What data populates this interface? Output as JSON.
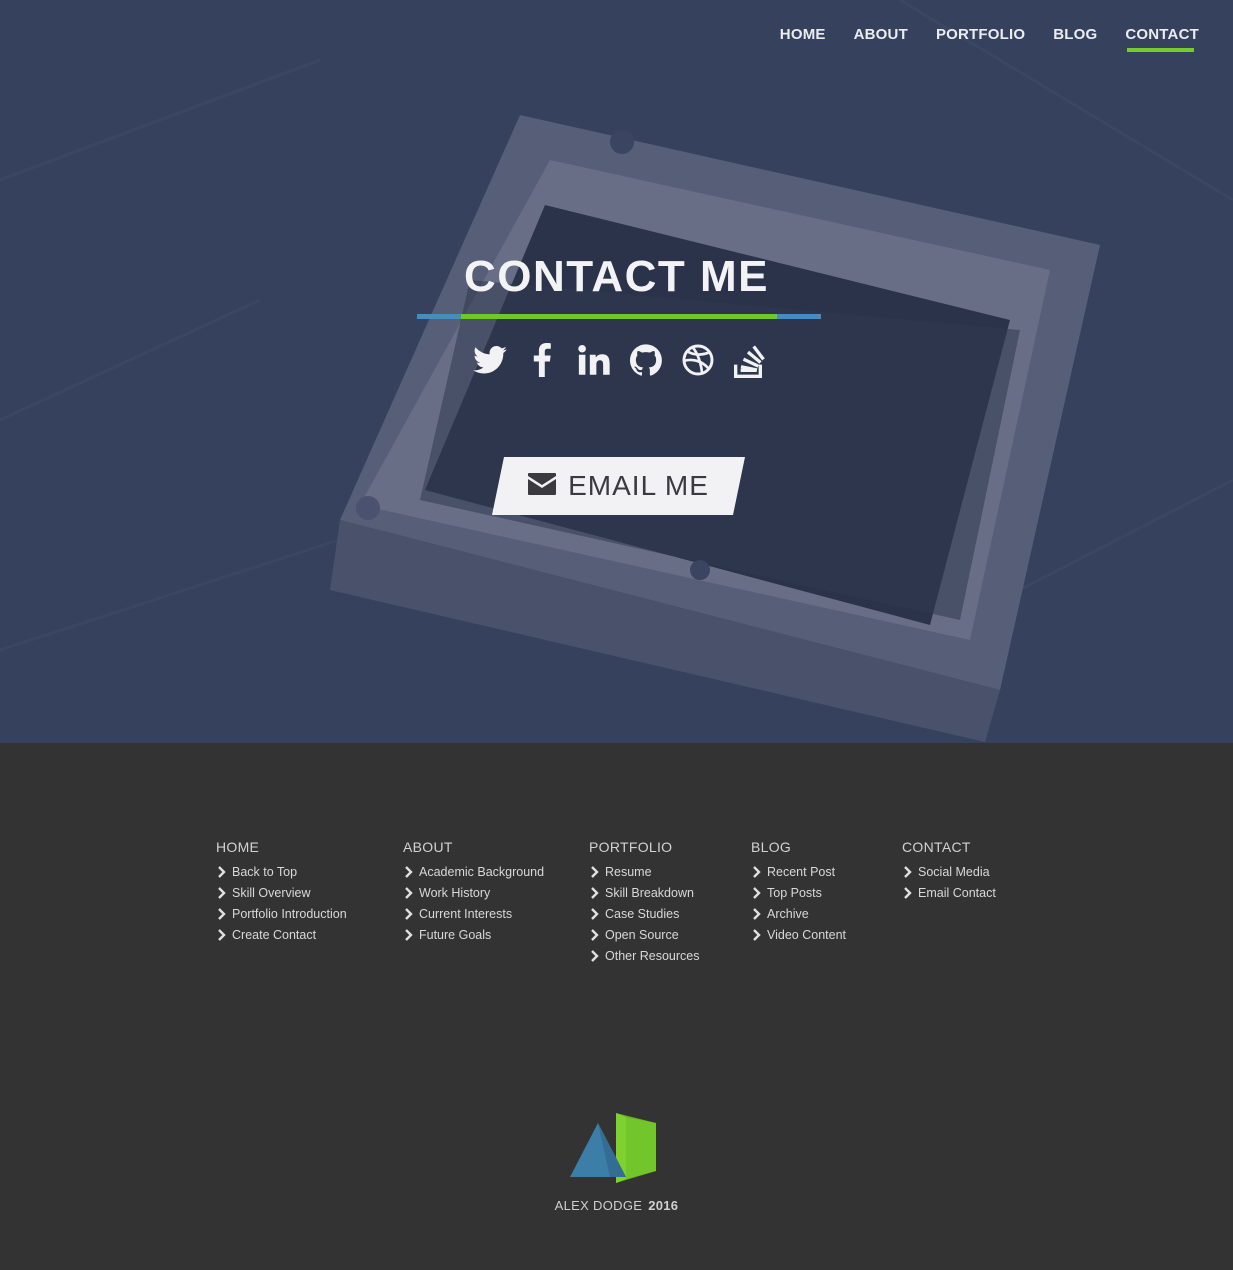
{
  "nav": {
    "items": [
      "HOME",
      "ABOUT",
      "PORTFOLIO",
      "BLOG",
      "CONTACT"
    ],
    "active": "CONTACT"
  },
  "hero": {
    "title": "CONTACT ME",
    "email_button": "EMAIL ME",
    "social_icons": [
      "twitter-icon",
      "facebook-icon",
      "linkedin-icon",
      "github-icon",
      "dribbble-icon",
      "stackoverflow-icon"
    ]
  },
  "footer": {
    "columns": [
      {
        "heading": "HOME",
        "links": [
          "Back to Top",
          "Skill Overview",
          "Portfolio Introduction",
          "Create Contact"
        ]
      },
      {
        "heading": "ABOUT",
        "links": [
          "Academic Background",
          "Work History",
          "Current Interests",
          "Future Goals"
        ]
      },
      {
        "heading": "PORTFOLIO",
        "links": [
          "Resume",
          "Skill Breakdown",
          "Case Studies",
          "Open Source",
          "Other Resources"
        ]
      },
      {
        "heading": "BLOG",
        "links": [
          "Recent Post",
          "Top Posts",
          "Archive",
          "Video Content"
        ]
      },
      {
        "heading": "CONTACT",
        "links": [
          "Social Media",
          "Email Contact"
        ]
      }
    ],
    "copyright_name": "ALEX DODGE",
    "copyright_year": "2016"
  },
  "colors": {
    "accent_green": "#77cc2a",
    "accent_blue": "#4a8bbd",
    "hero_overlay": "#3a4563",
    "footer_bg": "#333333"
  }
}
